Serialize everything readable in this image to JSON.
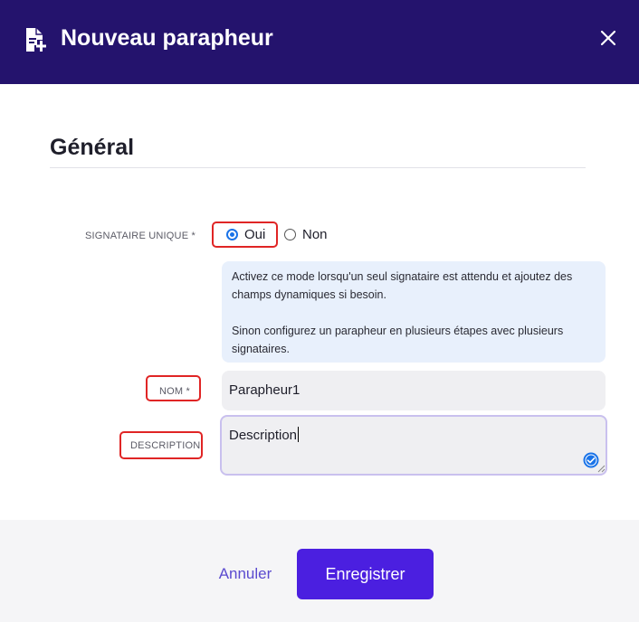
{
  "header": {
    "title": "Nouveau parapheur",
    "icon": "document-add-icon",
    "close_icon": "close-icon",
    "background": "#24136d"
  },
  "section": {
    "title": "Général"
  },
  "form": {
    "signataire_unique": {
      "label": "SIGNATAIRE UNIQUE *",
      "options": [
        "Oui",
        "Non"
      ],
      "selected": "Oui"
    },
    "info": {
      "paragraph1": "Activez ce mode lorsqu'un seul signataire est attendu et ajoutez des champs dynamiques si besoin.",
      "paragraph2": "Sinon configurez un parapheur en plusieurs étapes avec plusieurs signataires."
    },
    "nom": {
      "label": "NOM *",
      "value": "Parapheur1"
    },
    "description": {
      "label": "DESCRIPTION",
      "value": "Description"
    }
  },
  "footer": {
    "cancel_label": "Annuler",
    "save_label": "Enregistrer",
    "accent": "#4b1fe0"
  }
}
